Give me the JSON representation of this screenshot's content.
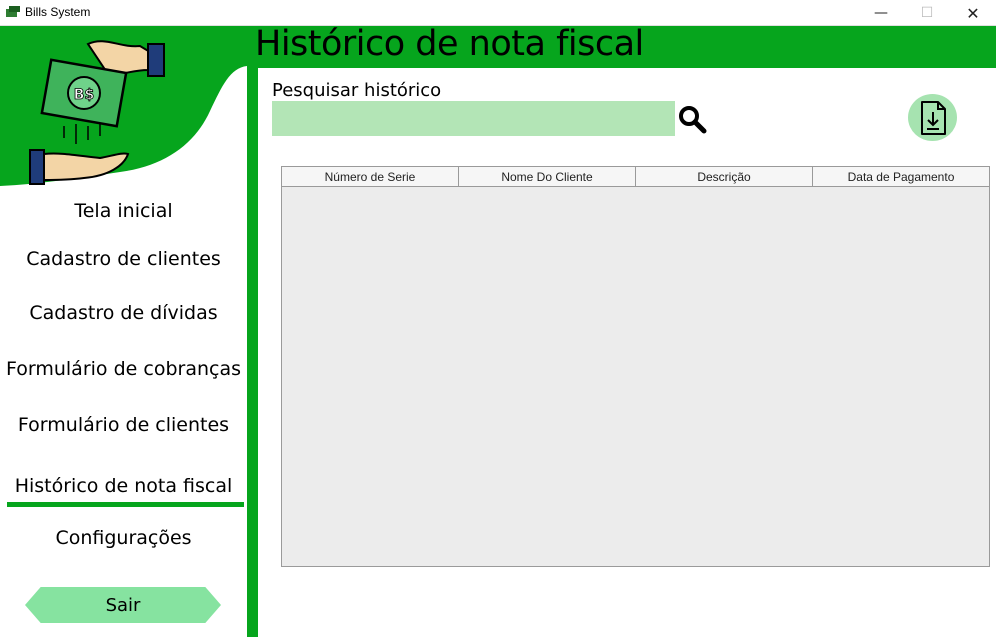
{
  "window": {
    "title": "Bills System",
    "controls": {
      "minimize": "—",
      "maximize": "☐",
      "close": "✕"
    }
  },
  "header": {
    "title": "Histórico de nota fiscal"
  },
  "sidebar": {
    "items": [
      {
        "label": "Tela inicial"
      },
      {
        "label": "Cadastro de clientes"
      },
      {
        "label": "Cadastro de dívidas"
      },
      {
        "label": "Formulário de cobranças"
      },
      {
        "label": "Formulário de clientes"
      },
      {
        "label": "Histórico de nota fiscal",
        "active": true
      },
      {
        "label": "Configurações"
      }
    ],
    "logout_label": "Sair",
    "logo_text": "B$"
  },
  "search": {
    "label": "Pesquisar histórico",
    "value": "",
    "placeholder": ""
  },
  "table": {
    "columns": [
      "Número de Serie",
      "Nome Do Cliente",
      "Descrição",
      "Data de Pagamento"
    ],
    "rows": []
  },
  "colors": {
    "brand_green": "#06a51d",
    "light_green": "#b3e5b6",
    "button_green": "#86e3a0",
    "icon_circle": "#a6e3b0"
  },
  "icons": {
    "search": "search-icon",
    "download": "file-download-icon",
    "logo": "money-hands-logo"
  }
}
